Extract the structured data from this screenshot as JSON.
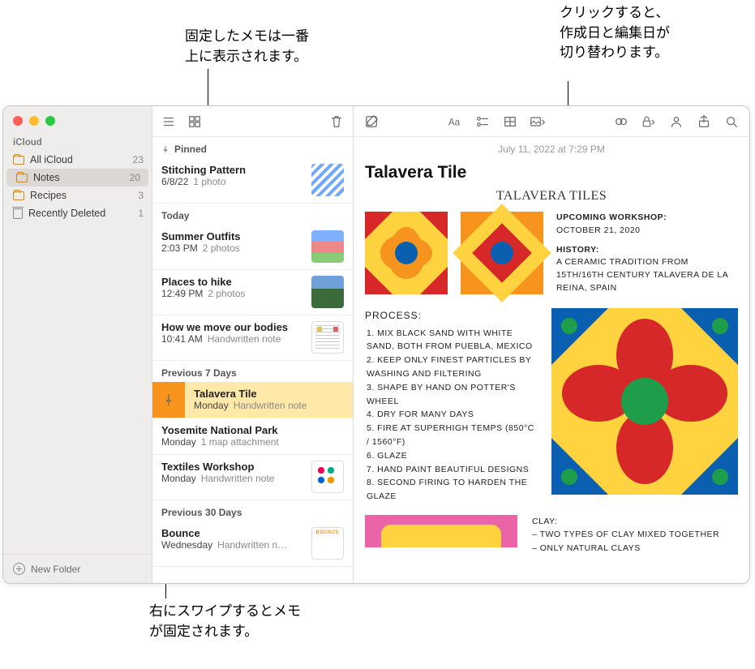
{
  "callouts": {
    "pinned_top": "固定したメモは一番\n上に表示されます。",
    "dates_toggle": "クリックすると、\n作成日と編集日が\n切り替わります。",
    "swipe_pin": "右にスワイプするとメモ\nが固定されます。"
  },
  "sidebar": {
    "account": "iCloud",
    "folders": [
      {
        "name": "All iCloud",
        "count": "23"
      },
      {
        "name": "Notes",
        "count": "20",
        "selected": true
      },
      {
        "name": "Recipes",
        "count": "3"
      },
      {
        "name": "Recently Deleted",
        "count": "1",
        "trash": true
      }
    ],
    "new_folder": "New Folder"
  },
  "list": {
    "sections": {
      "pinned": "Pinned",
      "today": "Today",
      "prev7": "Previous 7 Days",
      "prev30": "Previous 30 Days"
    },
    "pinned": [
      {
        "title": "Stitching Pattern",
        "time": "6/8/22",
        "detail": "1 photo"
      }
    ],
    "today": [
      {
        "title": "Summer Outfits",
        "time": "2:03 PM",
        "detail": "2 photos"
      },
      {
        "title": "Places to hike",
        "time": "12:49 PM",
        "detail": "2 photos"
      },
      {
        "title": "How we move our bodies",
        "time": "10:41 AM",
        "detail": "Handwritten note"
      }
    ],
    "prev7": [
      {
        "title": "Talavera Tile",
        "time": "Monday",
        "detail": "Handwritten note",
        "selected": true
      },
      {
        "title": "Yosemite National Park",
        "time": "Monday",
        "detail": "1 map attachment"
      },
      {
        "title": "Textiles Workshop",
        "time": "Monday",
        "detail": "Handwritten note"
      }
    ],
    "prev30": [
      {
        "title": "Bounce",
        "time": "Wednesday",
        "detail": "Handwritten n…"
      }
    ]
  },
  "editor": {
    "timestamp": "July 11, 2022 at 7:29 PM",
    "title": "Talavera Tile",
    "hand_title": "Talavera Tiles",
    "workshop_label": "Upcoming Workshop:",
    "workshop_date": "October 21, 2020",
    "history_label": "History:",
    "history_body": "A ceramic tradition from 15th/16th century Talavera de la Reina, Spain",
    "process_label": "Process:",
    "process_steps": [
      "Mix black sand with white sand, both from Puebla, Mexico",
      "Keep only finest particles by washing and filtering",
      "Shape by hand on potter's wheel",
      "Dry for many days",
      "Fire at superhigh temps (850°C / 1560°F)",
      "Glaze",
      "Hand paint beautiful designs",
      "Second firing to harden the glaze"
    ],
    "clay_label": "Clay:",
    "clay_lines": [
      "Two types of clay mixed together",
      "Only natural clays"
    ]
  }
}
